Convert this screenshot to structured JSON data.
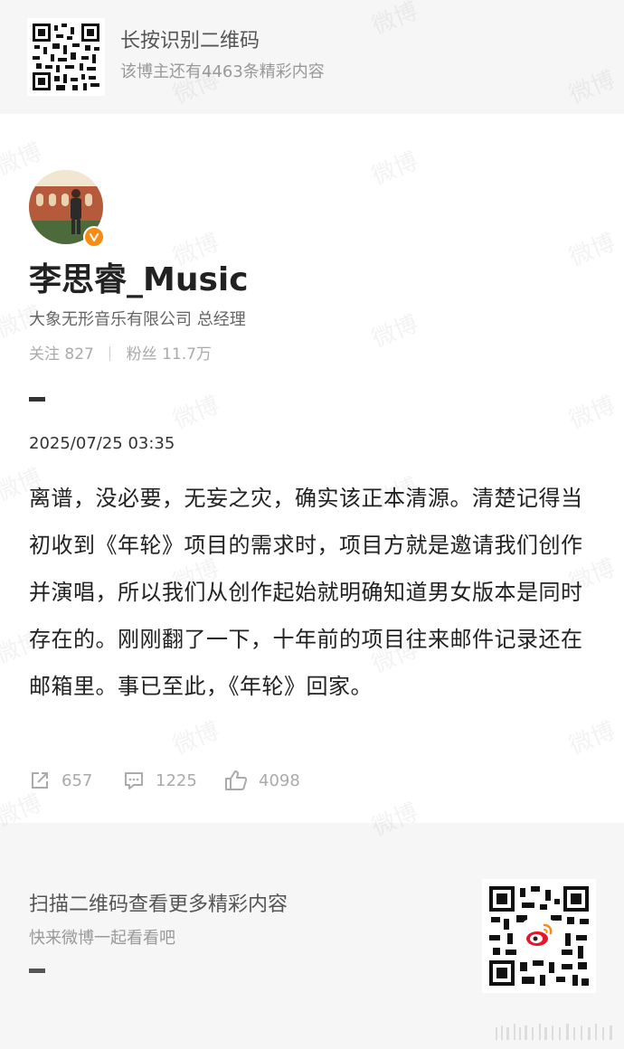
{
  "qr_banner": {
    "title": "长按识别二维码",
    "subtitle": "该博主还有4463条精彩内容"
  },
  "profile": {
    "name": "李思睿_Music",
    "description": "大象无形音乐有限公司 总经理",
    "following_label": "关注",
    "following_count": "827",
    "followers_label": "粉丝",
    "followers_count": "11.7万"
  },
  "post": {
    "time": "2025/07/25 03:35",
    "body": "离谱，没必要，无妄之灾，确实该正本清源。清楚记得当初收到《年轮》项目的需求时，项目方就是邀请我们创作并演唱，所以我们从创作起始就明确知道男女版本是同时存在的。刚刚翻了一下，十年前的项目往来邮件记录还在邮箱里。事已至此，《年轮》回家。",
    "reposts": "657",
    "comments": "1225",
    "likes": "4098"
  },
  "footer": {
    "title": "扫描二维码查看更多精彩内容",
    "subtitle": "快来微博一起看看吧"
  },
  "watermark_text": "微博",
  "colors": {
    "verified_badge": "#f78b13",
    "weibo_red": "#e6162d",
    "background_gray": "#f6f6f6"
  }
}
